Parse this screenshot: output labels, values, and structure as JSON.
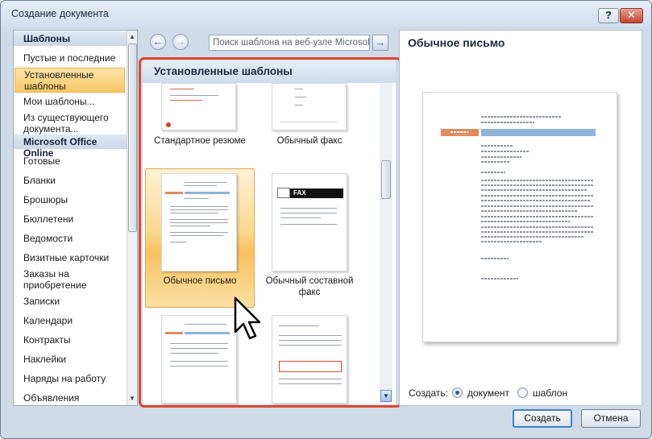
{
  "window": {
    "title": "Создание документа",
    "help_glyph": "?",
    "close_glyph": "✕"
  },
  "sidebar": {
    "section_templates": "Шаблоны",
    "items": [
      "Пустые и последние",
      "Установленные шаблоны",
      "Мои шаблоны...",
      "Из существующего документа..."
    ],
    "section_online": "Microsoft Office Online",
    "online_items": [
      "Готовые",
      "Бланки",
      "Брошюры",
      "Бюллетени",
      "Ведомости",
      "Визитные карточки",
      "Заказы на приобретение",
      "Записки",
      "Календари",
      "Контракты",
      "Наклейки",
      "Наряды на работу",
      "Объявления"
    ],
    "selected_item": "Установленные шаблоны"
  },
  "toolbar": {
    "search_placeholder": "Поиск шаблона на веб-узле Microsoft",
    "back_glyph": "←",
    "forward_glyph": "→",
    "go_glyph": "→"
  },
  "center": {
    "heading": "Установленные шаблоны",
    "templates": [
      "Стандартное резюме",
      "Обычный факс",
      "Обычное письмо",
      "Обычный составной факс"
    ],
    "fax_badge": "FAX",
    "selected_template": "Обычное письмо"
  },
  "preview": {
    "title": "Обычное письмо"
  },
  "footer": {
    "create_label": "Создать:",
    "option_document": "документ",
    "option_template": "шаблон",
    "selected_option": "документ",
    "create_button": "Создать",
    "cancel_button": "Отмена"
  },
  "colors": {
    "selection_orange": "#f9c766",
    "highlight_frame": "#e1462e",
    "accent_blue": "#8fb3d9"
  }
}
